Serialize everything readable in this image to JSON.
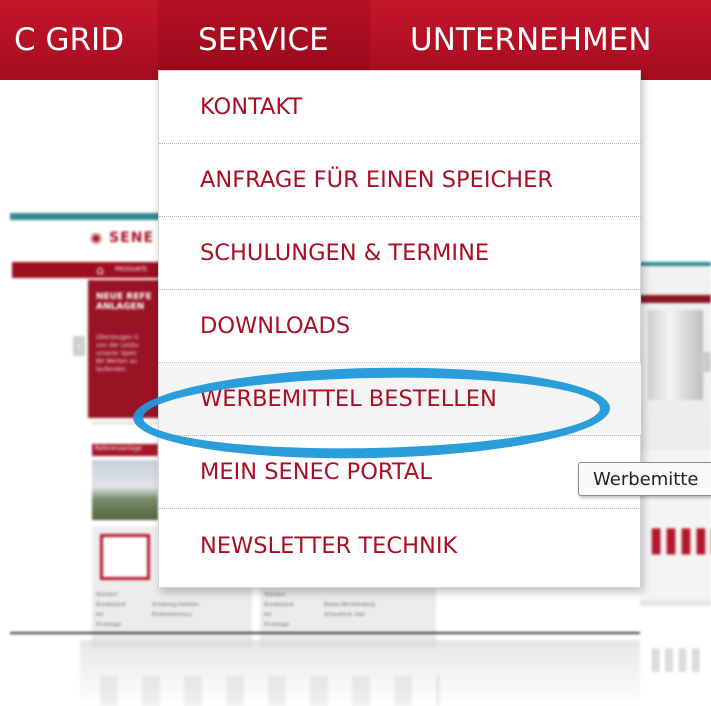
{
  "topnav": {
    "items": [
      {
        "label": "C GRID"
      },
      {
        "label": "SERVICE",
        "active": true
      },
      {
        "label": "UNTERNEHMEN"
      }
    ]
  },
  "dropdown": {
    "items": [
      {
        "label": "KONTAKT"
      },
      {
        "label": "ANFRAGE FÜR EINEN SPEICHER"
      },
      {
        "label": "SCHULUNGEN & TERMINE"
      },
      {
        "label": "DOWNLOADS"
      },
      {
        "label": "WERBEMITTEL BESTELLEN",
        "hovered": true
      },
      {
        "label": "MEIN SENEC PORTAL"
      },
      {
        "label": "NEWSLETTER TECHNIK"
      }
    ]
  },
  "tooltip": {
    "text": "Werbemitte"
  },
  "background_page": {
    "logo": "SENE",
    "breadcrumb": "PRODUKTE",
    "panel_title": "NEUE REFE\nANLAGEN",
    "panel_text": "Überzeugen S\nvon der Leistu\nunserer Speic\nBit Werten au\nlaufenden",
    "reference_label": "Referenzanlage",
    "table_left": [
      [
        "Standort",
        ""
      ],
      [
        "Bundesland",
        "Schleswig-Holstein"
      ],
      [
        "Art",
        "Einfamilienhaus"
      ],
      [
        "PV-Anlage",
        ""
      ]
    ],
    "table_right": [
      [
        "Standort",
        ""
      ],
      [
        "Bundesland",
        "Baden-Württemberg"
      ],
      [
        "Art",
        "Schaufenst. Hall"
      ],
      [
        "PV-Anlage",
        ""
      ]
    ]
  },
  "colors": {
    "nav_red": "#b3132a",
    "menu_text": "#a80f24",
    "ring_blue": "#1f98d8"
  }
}
